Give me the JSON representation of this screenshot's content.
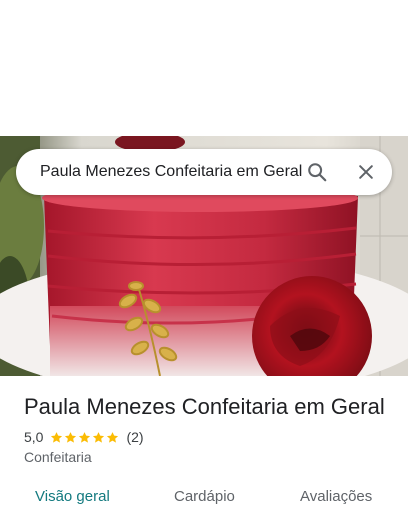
{
  "search": {
    "query": "Paula Menezes Confeitaria em Geral",
    "search_icon": "search-icon",
    "close_icon": "close-icon"
  },
  "place": {
    "name": "Paula Menezes Confeitaria em Geral",
    "rating": "5,0",
    "stars": 5,
    "review_count": "(2)",
    "category": "Confeitaria"
  },
  "tabs": [
    {
      "label": "Visão geral",
      "active": true
    },
    {
      "label": "Cardápio",
      "active": false
    },
    {
      "label": "Avaliações",
      "active": false
    }
  ],
  "colors": {
    "accent": "#137a7f",
    "star": "#fbbc04",
    "text": "#202124",
    "secondary_text": "#5f6368"
  }
}
